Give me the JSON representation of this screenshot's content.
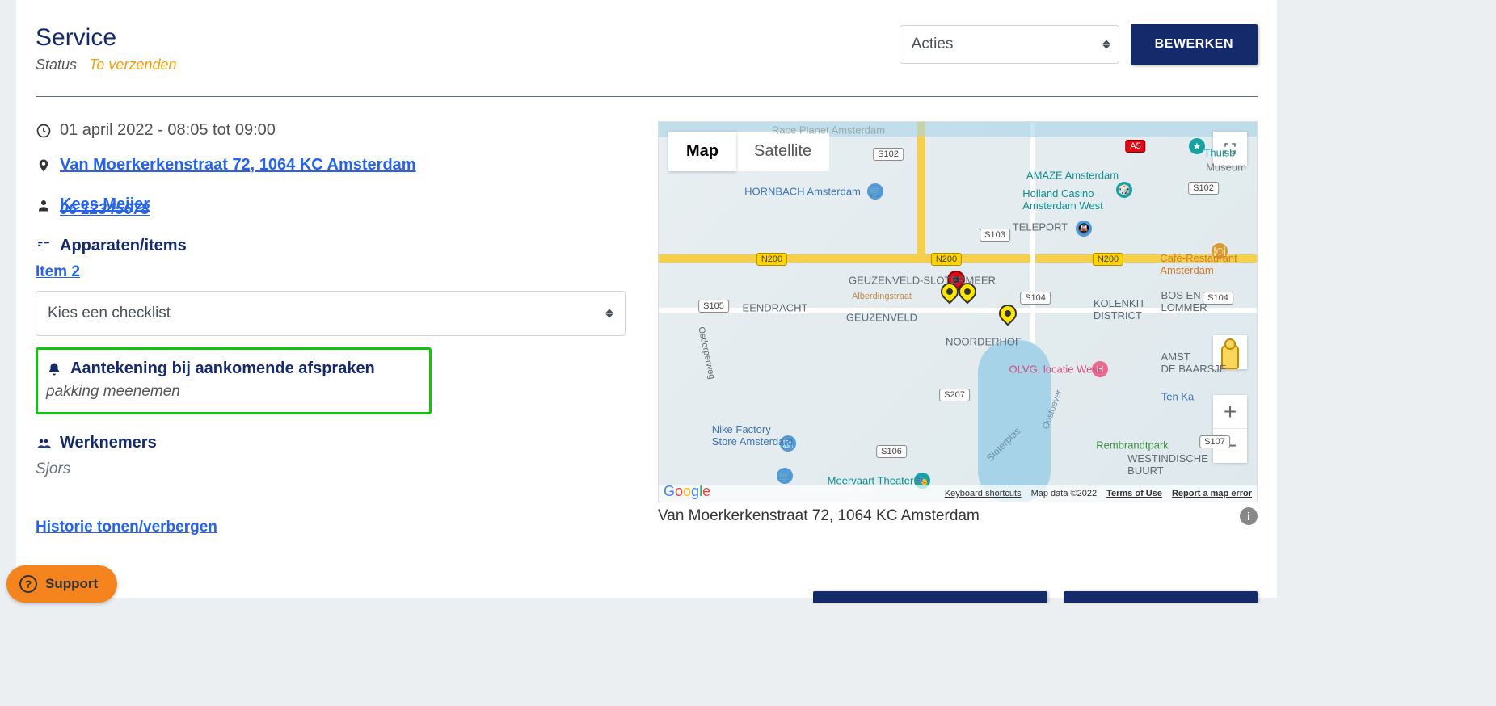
{
  "header": {
    "title": "Service",
    "status_label": "Status",
    "status_value": "Te verzenden",
    "actions_select": "Acties",
    "edit_button": "BEWERKEN"
  },
  "details": {
    "datetime": "01 april 2022 - 08:05 tot 09:00",
    "address": "Van Moerkerkenstraat 72, 1064 KC Amsterdam",
    "contact_name": "Kees Meijer",
    "contact_phone": "06 12345678",
    "devices_title": "Apparaten/items",
    "item": "Item 2",
    "checklist_placeholder": "Kies een checklist",
    "note_title": "Aantekening bij aankomende afspraken",
    "note_text": "pakking meenemen",
    "employees_title": "Werknemers",
    "employees_value": "Sjors",
    "history_toggle": "Historie tonen/verbergen"
  },
  "map": {
    "map_btn": "Map",
    "satellite_btn": "Satellite",
    "google": "Google",
    "attrib_keyboard": "Keyboard shortcuts",
    "attrib_data": "Map data ©2022",
    "attrib_terms": "Terms of Use",
    "attrib_report": "Report a map error",
    "caption": "Van Moerkerkenstraat 72, 1064 KC Amsterdam",
    "zoom_in": "+",
    "zoom_out": "−",
    "labels": {
      "hornbach": "HORNBACH Amsterdam",
      "amaze": "AMAZE Amsterdam",
      "holland": "Holland Casino\nAmsterdam West",
      "teleport": "TELEPORT",
      "geuzenveld": "GEUZENVELD-SLOTERMEER",
      "eendracht": "EENDRACHT",
      "geuzenveld2": "GEUZENVELD",
      "noorderhof": "NOORDERHOF",
      "kolenkit": "KOLENKIT\nDISTRICT",
      "boslommer": "BOS EN\nLOMMER",
      "cafe": "Café-Restaurant\nAmsterdam",
      "olvg": "OLVG, locatie West",
      "amst": "AMST\nDE BAARSJE",
      "tenka": "Ten Ka",
      "nike": "Nike Factory\nStore Amsterdam",
      "meervaart": "Meervaart Theater",
      "rembrandt": "Rembrandtpark",
      "westindisch": "WESTINDISCHE\nBUURT",
      "osdorperweg": "Osdorperweg",
      "alberdingk": "Alberdingstraat",
      "oostoever": "Oostoever",
      "sloterplas": "Sloterplas",
      "thuisb": "Thuisb",
      "museum": "Museum",
      "race": "Race Planet Amsterdam"
    },
    "shields": {
      "s102": "S102",
      "s103": "S103",
      "s104": "S104",
      "s105": "S105",
      "s106": "S106",
      "s107": "S107",
      "s207": "S207",
      "n200": "N200",
      "a5": "A5"
    }
  },
  "support": {
    "label": "Support"
  }
}
